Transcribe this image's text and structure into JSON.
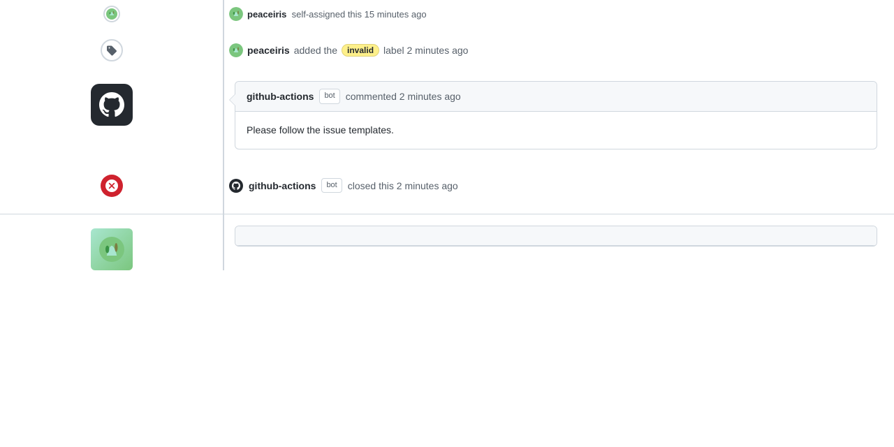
{
  "top_row": {
    "username": "peaceiris",
    "action": "self-assigned this 15 minutes ago",
    "avatar_alt": "peaceiris avatar"
  },
  "label_row": {
    "username": "peaceiris",
    "action_before": "added the",
    "label_text": "invalid",
    "action_after": "label 2 minutes ago",
    "avatar_alt": "peaceiris avatar"
  },
  "comment": {
    "commenter": "github-actions",
    "bot_label": "bot",
    "time": "commented 2 minutes ago",
    "body": "Please follow the issue templates.",
    "avatar_alt": "github-actions avatar"
  },
  "closed_row": {
    "username": "github-actions",
    "bot_label": "bot",
    "action": "closed this 2 minutes ago",
    "avatar_alt": "github-actions avatar"
  },
  "bottom_row": {
    "placeholder": "bottom partial item"
  },
  "icons": {
    "tag": "🏷",
    "octocat": "⊙",
    "close": "⊘"
  }
}
